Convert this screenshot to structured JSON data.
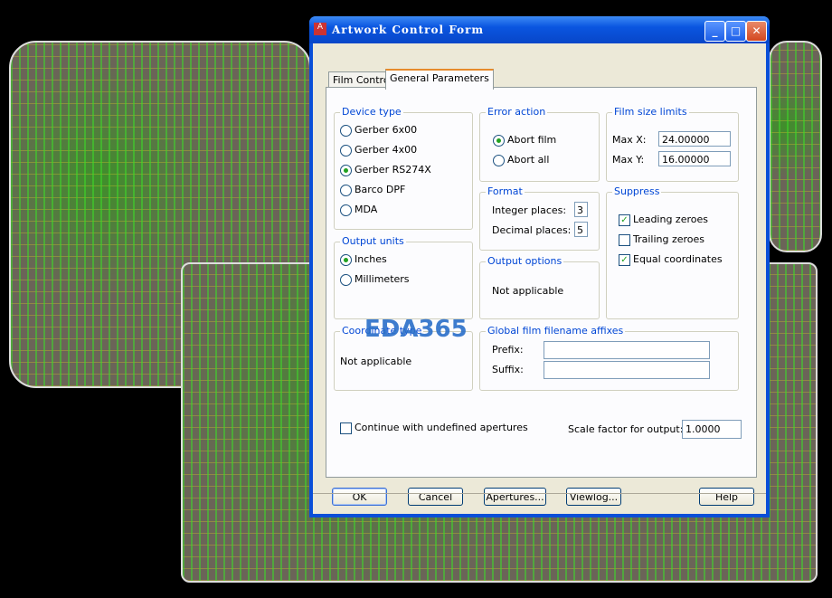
{
  "window": {
    "title": "Artwork Control Form",
    "minimize": "_",
    "maximize": "□",
    "close": "✕"
  },
  "tabs": [
    {
      "label": "Film Control",
      "active": false
    },
    {
      "label": "General Parameters",
      "active": true
    }
  ],
  "device_type": {
    "label": "Device type",
    "options": [
      "Gerber 6x00",
      "Gerber 4x00",
      "Gerber RS274X",
      "Barco DPF",
      "MDA"
    ],
    "selected": "Gerber RS274X"
  },
  "output_units": {
    "label": "Output units",
    "options": [
      "Inches",
      "Millimeters"
    ],
    "selected": "Inches"
  },
  "coordinate_type": {
    "label": "Coordinate type",
    "value": "Not applicable"
  },
  "error_action": {
    "label": "Error action",
    "options": [
      "Abort film",
      "Abort all"
    ],
    "selected": "Abort film"
  },
  "format": {
    "label": "Format",
    "integer_label": "Integer places:",
    "integer_value": "3",
    "decimal_label": "Decimal places:",
    "decimal_value": "5"
  },
  "output_options": {
    "label": "Output options",
    "value": "Not applicable"
  },
  "film_size": {
    "label": "Film size limits",
    "max_x_label": "Max X:",
    "max_x": "24.00000",
    "max_y_label": "Max Y:",
    "max_y": "16.00000"
  },
  "suppress": {
    "label": "Suppress",
    "leading": "Leading zeroes",
    "trailing": "Trailing zeroes",
    "equal": "Equal coordinates",
    "leading_checked": true,
    "trailing_checked": false,
    "equal_checked": true
  },
  "affixes": {
    "label": "Global film filename affixes",
    "prefix_label": "Prefix:",
    "prefix": "",
    "suffix_label": "Suffix:",
    "suffix": ""
  },
  "continue_undefined": {
    "label": "Continue with undefined apertures",
    "checked": false
  },
  "scale": {
    "label": "Scale factor for output:",
    "value": "1.0000"
  },
  "buttons": {
    "ok": "OK",
    "cancel": "Cancel",
    "apertures": "Apertures...",
    "viewlog": "Viewlog...",
    "help": "Help"
  },
  "watermark": "EDA365"
}
